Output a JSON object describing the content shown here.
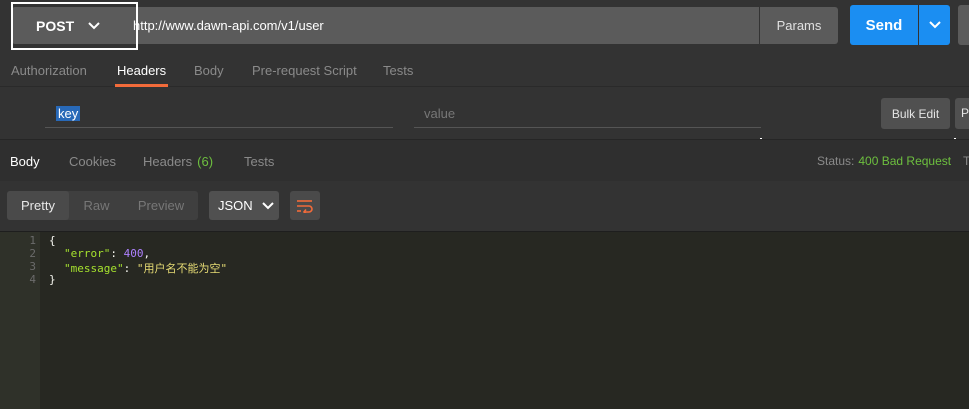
{
  "request": {
    "method": "POST",
    "url": "http://www.dawn-api.com/v1/user",
    "params_label": "Params",
    "send_label": "Send"
  },
  "request_tabs": [
    {
      "label": "Authorization"
    },
    {
      "label": "Headers"
    },
    {
      "label": "Body"
    },
    {
      "label": "Pre-request Script"
    },
    {
      "label": "Tests"
    }
  ],
  "headers_editor": {
    "key_value": "key",
    "value_placeholder": "value",
    "bulk_edit_label": "Bulk Edit",
    "presets_label_partial": "P"
  },
  "response_tabs": [
    {
      "label": "Body"
    },
    {
      "label": "Cookies"
    },
    {
      "label": "Headers",
      "count": "(6)"
    },
    {
      "label": "Tests"
    }
  ],
  "status": {
    "label": "Status:",
    "value": "400 Bad Request",
    "time_partial": "T"
  },
  "view_modes": [
    {
      "label": "Pretty"
    },
    {
      "label": "Raw"
    },
    {
      "label": "Preview"
    }
  ],
  "format": "JSON",
  "response_body": {
    "line_numbers": [
      "1",
      "2",
      "3",
      "4"
    ],
    "open_brace": "{",
    "close_brace": "}",
    "line2_key": "\"error\"",
    "line2_value": "400",
    "line3_key": "\"message\"",
    "line3_value": "\"用户名不能为空\""
  },
  "colors": {
    "send_blue": "#1b8ef2",
    "status_green": "#6dbf3f",
    "active_tab_orange": "#f26b3a"
  },
  "icons": {
    "method_dropdown": "chevron-down-icon",
    "send_dropdown": "chevron-down-icon",
    "format_dropdown": "chevron-down-icon",
    "wrap": "wrap-lines-icon"
  }
}
